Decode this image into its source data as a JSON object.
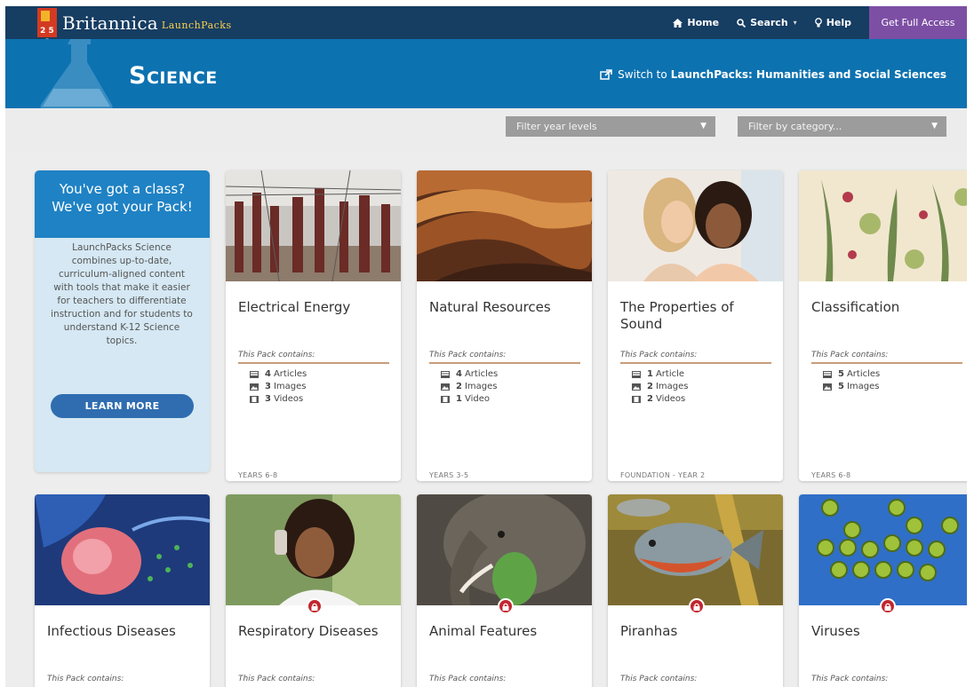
{
  "brand": {
    "name": "Britannica",
    "product": "LaunchPacks",
    "mark_text": "2 5 8"
  },
  "nav": {
    "home": "Home",
    "search": "Search",
    "help": "Help",
    "full_access": "Get Full Access"
  },
  "banner": {
    "title": "Science",
    "switch_prefix": "Switch to",
    "switch_link": "LaunchPacks: Humanities and Social Sciences"
  },
  "filters": {
    "year_levels": "Filter year levels",
    "category": "Filter by category..."
  },
  "promo": {
    "heading_line1": "You've got a class?",
    "heading_line2": "We've got your Pack!",
    "body": "LaunchPacks Science combines up-to-date, curriculum-aligned content with tools that make it easier for teachers to differentiate instruction and for students to understand K-12 Science topics.",
    "button": "LEARN MORE"
  },
  "contains_label": "This Pack contains:",
  "colors": {
    "topbar": "#163d62",
    "banner": "#0d72b0",
    "access": "#7d4fa4",
    "lock": "#c2262f",
    "promo_head": "#1f82c4"
  },
  "cards_row1": [
    {
      "title": "Electrical Energy",
      "articles_n": "4",
      "articles": "Articles",
      "images_n": "3",
      "images": "Images",
      "videos_n": "3",
      "videos": "Videos",
      "years": "YEARS 6-8"
    },
    {
      "title": "Natural Resources",
      "articles_n": "4",
      "articles": "Articles",
      "images_n": "2",
      "images": "Images",
      "videos_n": "1",
      "videos": "Video",
      "years": "YEARS 3-5"
    },
    {
      "title": "The Properties of Sound",
      "articles_n": "1",
      "articles": "Article",
      "images_n": "2",
      "images": "Images",
      "videos_n": "2",
      "videos": "Videos",
      "years": "FOUNDATION - YEAR 2"
    },
    {
      "title": "Classification",
      "articles_n": "5",
      "articles": "Articles",
      "images_n": "5",
      "images": "Images",
      "years": "YEARS 6-8"
    }
  ],
  "cards_row2": [
    {
      "title": "Infectious Diseases",
      "locked": false
    },
    {
      "title": "Respiratory Diseases",
      "locked": true
    },
    {
      "title": "Animal Features",
      "locked": true
    },
    {
      "title": "Piranhas",
      "locked": true
    },
    {
      "title": "Viruses",
      "locked": true
    }
  ]
}
